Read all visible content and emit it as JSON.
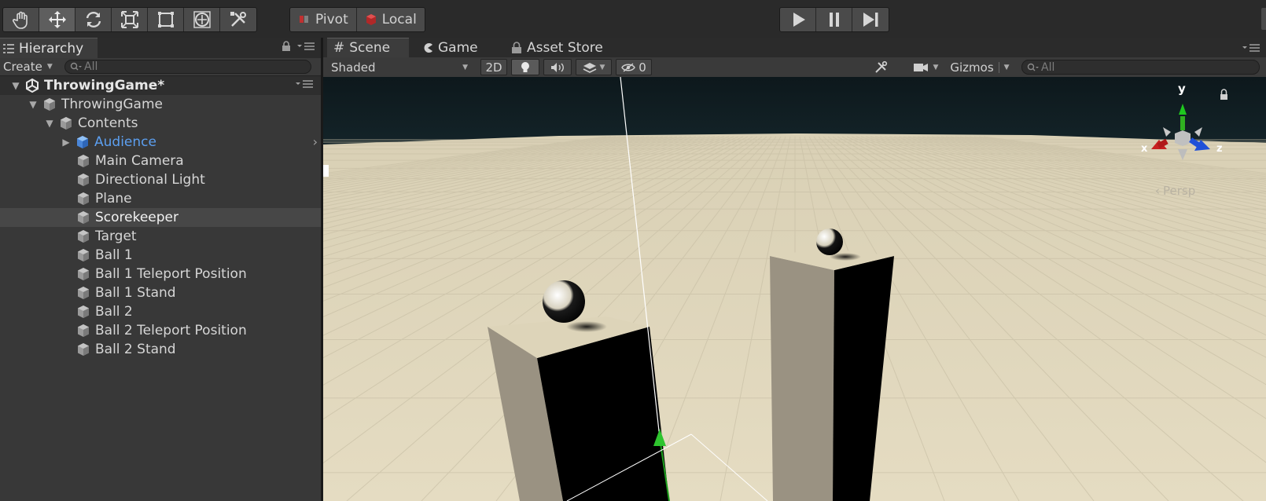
{
  "toolbar": {
    "tools": [
      {
        "name": "hand-tool-icon",
        "active": false
      },
      {
        "name": "move-tool-icon",
        "active": true
      },
      {
        "name": "rotate-tool-icon",
        "active": false
      },
      {
        "name": "scale-tool-icon",
        "active": false
      },
      {
        "name": "rect-tool-icon",
        "active": false
      },
      {
        "name": "transform-tool-icon",
        "active": false
      },
      {
        "name": "custom-tool-icon",
        "active": false
      }
    ],
    "pivot_label": "Pivot",
    "local_label": "Local",
    "playback": [
      "play-icon",
      "pause-icon",
      "step-icon"
    ]
  },
  "hierarchy": {
    "tab_label": "Hierarchy",
    "create_label": "Create",
    "search_placeholder": "All",
    "scene_name": "ThrowingGame*",
    "root": "ThrowingGame",
    "contents": "Contents",
    "items": [
      {
        "label": "Audience",
        "prefab": true,
        "expandable": true
      },
      {
        "label": "Main Camera"
      },
      {
        "label": "Directional Light"
      },
      {
        "label": "Plane"
      },
      {
        "label": "Scorekeeper",
        "selected": true
      },
      {
        "label": "Target"
      },
      {
        "label": "Ball 1"
      },
      {
        "label": "Ball 1 Teleport Position"
      },
      {
        "label": "Ball 1 Stand"
      },
      {
        "label": "Ball 2"
      },
      {
        "label": "Ball 2 Teleport Position"
      },
      {
        "label": "Ball 2 Stand"
      }
    ]
  },
  "scene_panel": {
    "tabs": [
      "Scene",
      "Game",
      "Asset Store"
    ],
    "active_tab": "Scene",
    "shading_mode": "Shaded",
    "mode_2d": "2D",
    "hidden_count": "0",
    "gizmos_label": "Gizmos",
    "search_placeholder": "All",
    "projection_label": "Persp",
    "axis_labels": {
      "x": "x",
      "y": "y",
      "z": "z"
    }
  },
  "colors": {
    "accent_prefab": "#5c9ff0",
    "floor": "#ddd3b8",
    "sky": "#0e1a1e",
    "gizmo_x": "#c82020",
    "gizmo_y": "#30b020",
    "gizmo_z": "#2050d8"
  }
}
